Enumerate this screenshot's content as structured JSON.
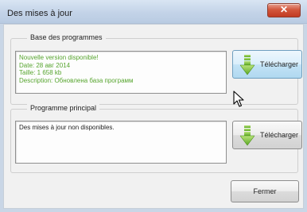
{
  "window": {
    "title": "Des mises à jour",
    "close_glyph": "✕"
  },
  "program_base": {
    "legend": "Base des programmes",
    "lines": [
      "Nouvelle version disponible!",
      "Date:  28 авг 2014",
      "Taille: 1 658 kb",
      "Description:  Обновлена база программ"
    ],
    "text_color": "#57a52f",
    "download_label": "Télécharger",
    "download_icon": "download-arrow-icon"
  },
  "main_program": {
    "legend": "Programme principal",
    "message": "Des mises à jour non disponibles.",
    "download_label": "Télécharger",
    "download_icon": "download-arrow-icon"
  },
  "footer": {
    "close_label": "Fermer"
  }
}
